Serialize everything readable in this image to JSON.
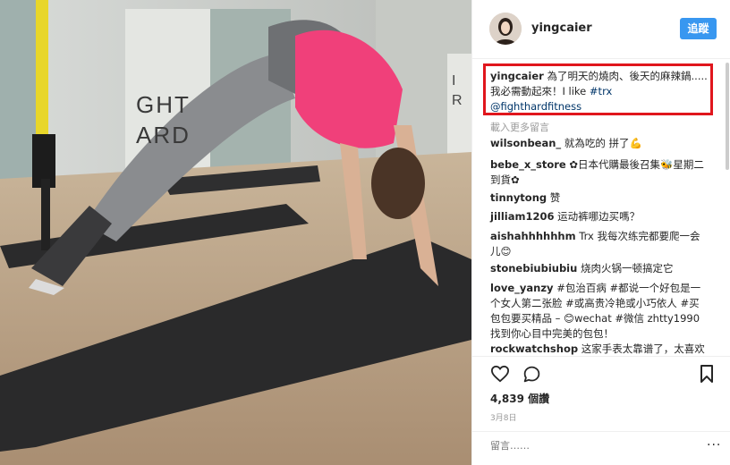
{
  "post": {
    "username": "yingcaier",
    "follow_label": "追蹤",
    "caption": {
      "user": "yingcaier",
      "text": "為了明天的燒肉、後天的麻辣鍋.....我必需動起來！I like ",
      "hashtag": "#trx",
      "mention": "@fighthardfitness"
    },
    "more_comments_label": "載入更多留言",
    "comments": [
      {
        "user": "wilsonbean_",
        "text": "就為吃的 拼了💪"
      },
      {
        "user": "bebe_x_store",
        "text": "✿日本代購最後召集🐝星期二到貨✿"
      },
      {
        "user": "tinnytong",
        "text": "赞"
      },
      {
        "user": "jilliam1206",
        "text": "运动裤哪边买嗎？"
      },
      {
        "user": "aishahhhhhhm",
        "text": "Trx 我每次练完都要爬一会儿😊"
      },
      {
        "user": "stonebiubiubiu",
        "text": "烧肉火锅一顿搞定它"
      },
      {
        "user": "love_yanzy",
        "text": "#包治百病 #都说一个好包是一个女人第二张脸 #或高贵冷艳或小巧依人 #买包包要买精品 – 😊wechat #微信 zhtty1990 找到你心目中完美的包包！"
      },
      {
        "user": "rockwatchshop",
        "text": "这家手表太靠谱了，太喜欢"
      }
    ],
    "likes_text": "4,839 個讚",
    "date_text": "3月8日",
    "add_comment_placeholder": "留言……",
    "options_label": "···"
  },
  "photo": {
    "wall_text_left": "GHT ARD",
    "wall_text_right": "I R"
  },
  "colors": {
    "follow_button": "#3897f0",
    "highlight_border": "#e0161d",
    "link": "#003569"
  },
  "icons": [
    "heart-icon",
    "comment-icon",
    "bookmark-icon",
    "more-options-icon"
  ]
}
